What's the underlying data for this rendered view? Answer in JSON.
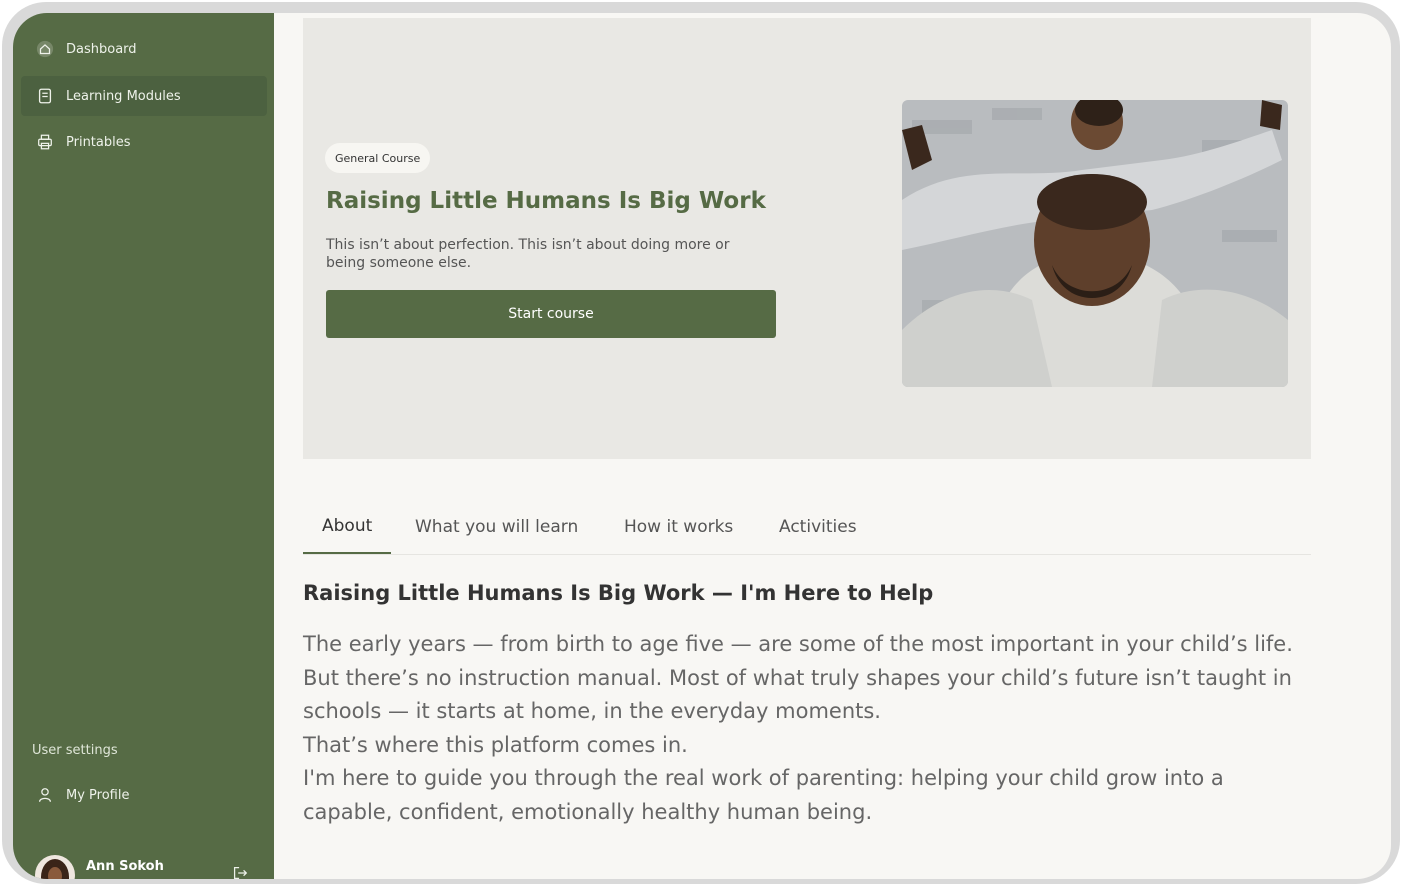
{
  "sidebar": {
    "items": [
      {
        "label": "Dashboard",
        "icon": "home-icon"
      },
      {
        "label": "Learning Modules",
        "icon": "document-icon"
      },
      {
        "label": "Printables",
        "icon": "printer-icon"
      }
    ],
    "settings_label": "User settings",
    "profile_label": "My Profile",
    "user_name": "Ann Sokoh"
  },
  "hero": {
    "badge": "General Course",
    "title": "Raising Little Humans Is Big Work",
    "description": "This isn’t about perfection. This isn’t about doing more or being someone else.",
    "cta": "Start course"
  },
  "tabs": [
    "About",
    "What you will learn",
    "How it works",
    "Activities"
  ],
  "about": {
    "heading": "Raising Little Humans Is Big Work — I'm Here to Help",
    "paragraphs": [
      "The early years — from birth to age five — are some of the most important in your child’s life. But there’s no instruction manual. Most of what truly shapes your child’s future isn’t taught in schools — it starts at home, in the everyday moments.",
      "That’s where this platform comes in.",
      "I'm here to guide you through the real work of parenting: helping your child grow into a capable, confident, emotionally healthy human being."
    ]
  },
  "colors": {
    "brand_green": "#566b45",
    "active_item": "#4c6140",
    "hero_background": "#e9e8e4"
  }
}
